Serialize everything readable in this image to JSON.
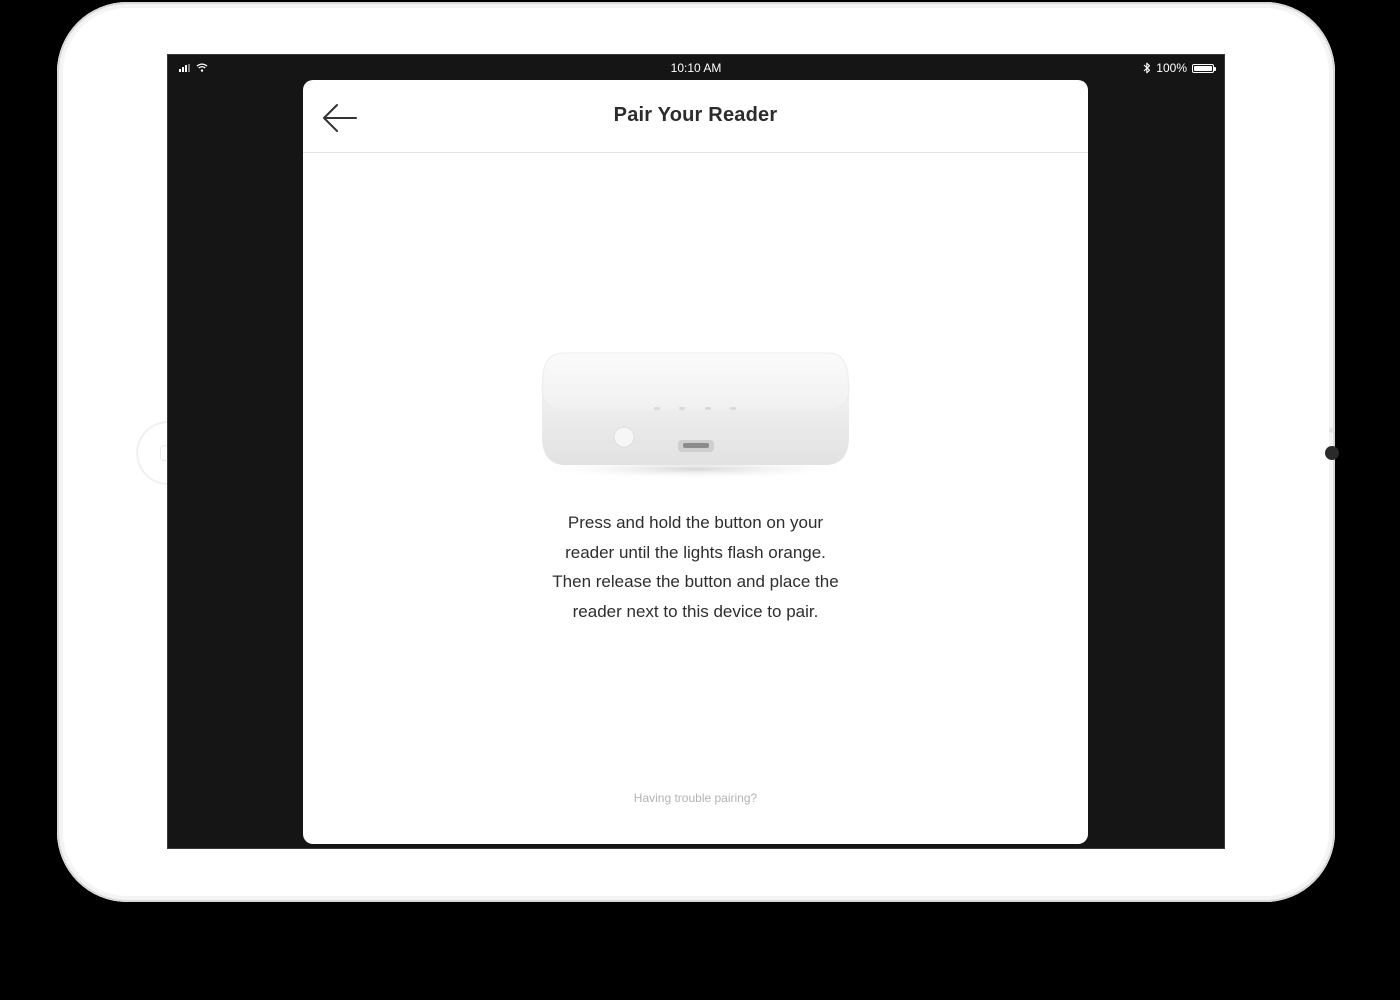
{
  "status_bar": {
    "time": "10:10 AM",
    "battery_text": "100%",
    "signal_icon": "cellular-signal-icon",
    "wifi_icon": "wifi-icon",
    "bluetooth_icon": "bluetooth-icon",
    "battery_icon": "battery-icon",
    "battery_level": 1.0
  },
  "modal": {
    "title": "Pair Your Reader",
    "back_icon": "back-arrow-icon",
    "illustration": "card-reader-device",
    "instructions": [
      "Press and hold the button on your",
      "reader until the lights flash orange.",
      "Then release the button and place the",
      "reader next to this device to pair."
    ],
    "trouble_link": "Having trouble pairing?"
  },
  "colors": {
    "screen_background": "#151515",
    "modal_background": "#ffffff",
    "title_text": "#2c2c2c",
    "link_text": "#b3b3b3"
  }
}
